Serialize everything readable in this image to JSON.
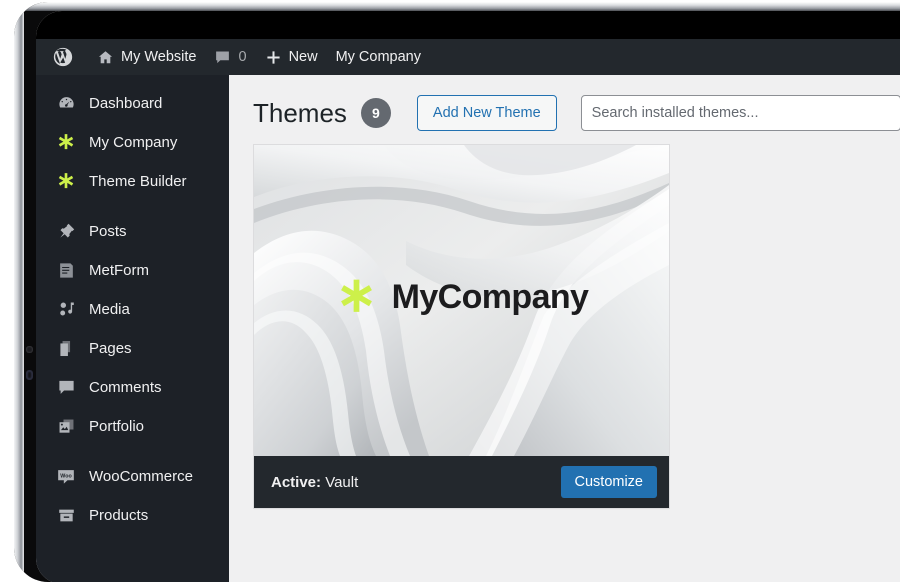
{
  "admin_bar": {
    "wp_logo_icon": "wordpress-logo-icon",
    "items": [
      {
        "icon": "home-icon",
        "label": "My Website"
      },
      {
        "icon": "comment-bubble-icon",
        "label": "0"
      },
      {
        "icon": "plus-icon",
        "label": "New"
      },
      {
        "icon": "",
        "label": "My Company"
      }
    ]
  },
  "sidebar": {
    "items": [
      {
        "label": "Dashboard",
        "icon": "dashboard-gauge-icon",
        "accent": false,
        "separator_before": false
      },
      {
        "label": "My Company",
        "icon": "asterisk-icon",
        "accent": true,
        "separator_before": false
      },
      {
        "label": "Theme Builder",
        "icon": "asterisk-icon",
        "accent": true,
        "separator_before": false
      },
      {
        "label": "Posts",
        "icon": "pin-icon",
        "accent": false,
        "separator_before": true
      },
      {
        "label": "MetForm",
        "icon": "form-icon",
        "accent": false,
        "separator_before": false
      },
      {
        "label": "Media",
        "icon": "media-icon",
        "accent": false,
        "separator_before": false
      },
      {
        "label": "Pages",
        "icon": "pages-icon",
        "accent": false,
        "separator_before": false
      },
      {
        "label": "Comments",
        "icon": "comment-bubble-icon",
        "accent": false,
        "separator_before": false
      },
      {
        "label": "Portfolio",
        "icon": "portfolio-images-icon",
        "accent": false,
        "separator_before": false
      },
      {
        "label": "WooCommerce",
        "icon": "woocommerce-icon",
        "accent": false,
        "separator_before": true
      },
      {
        "label": "Products",
        "icon": "products-box-icon",
        "accent": false,
        "separator_before": false
      }
    ]
  },
  "main": {
    "page_title": "Themes",
    "theme_count": "9",
    "add_new_theme_label": "Add New Theme",
    "search_placeholder": "Search installed themes...",
    "theme_card": {
      "brand_name": "MyCompany",
      "brand_icon": "asterisk-icon",
      "active_label": "Active:",
      "active_theme_name": "Vault",
      "customize_label": "Customize"
    }
  },
  "colors": {
    "admin_bar_bg": "#23282d",
    "sidebar_bg": "#1d2127",
    "content_bg": "#f0f0f1",
    "accent_green": "#cdf04a",
    "link_blue": "#2271b1",
    "badge_grey": "#646970"
  }
}
